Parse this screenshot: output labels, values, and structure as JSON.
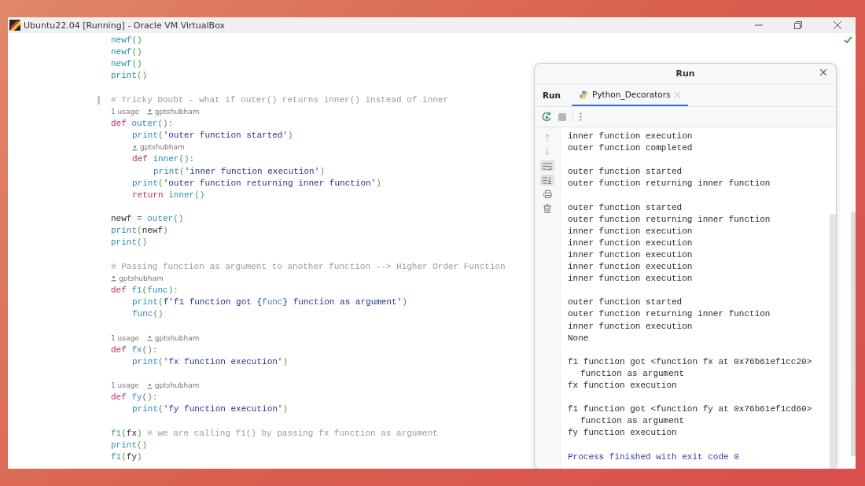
{
  "window": {
    "title": "Ubuntu22.04 [Running] - Oracle VM VirtualBox"
  },
  "editor": {
    "lines": [
      {
        "kind": "code",
        "tokens": [
          {
            "kind": "function",
            "t": "newf"
          },
          {
            "kind": "punct",
            "t": "()"
          }
        ]
      },
      {
        "kind": "code",
        "tokens": [
          {
            "kind": "function",
            "t": "newf"
          },
          {
            "kind": "punct",
            "t": "()"
          }
        ]
      },
      {
        "kind": "code",
        "tokens": [
          {
            "kind": "function",
            "t": "newf"
          },
          {
            "kind": "punct",
            "t": "()"
          }
        ]
      },
      {
        "kind": "code",
        "tokens": [
          {
            "kind": "function",
            "t": "print"
          },
          {
            "kind": "punct",
            "t": "()"
          }
        ]
      },
      {
        "kind": "blank"
      },
      {
        "kind": "code",
        "marked": true,
        "tokens": [
          {
            "kind": "comment",
            "t": "# Tricky Doubt - what if outer() returns inner() instead of inner"
          }
        ]
      },
      {
        "kind": "hint",
        "usage": "1 usage",
        "author": "gptshubham"
      },
      {
        "kind": "code",
        "tokens": [
          {
            "kind": "keyword",
            "t": "def "
          },
          {
            "kind": "function",
            "t": "outer"
          },
          {
            "kind": "punct",
            "t": "():"
          }
        ],
        "children": [
          {
            "kind": "code",
            "tokens": [
              {
                "kind": "function",
                "t": "print"
              },
              {
                "kind": "punct",
                "t": "("
              },
              {
                "kind": "string",
                "t": "'outer function started'"
              },
              {
                "kind": "punct",
                "t": ")"
              }
            ]
          },
          {
            "kind": "hint",
            "author": "gptshubham"
          },
          {
            "kind": "code",
            "tokens": [
              {
                "kind": "keyword",
                "t": "def "
              },
              {
                "kind": "function",
                "t": "inner"
              },
              {
                "kind": "punct",
                "t": "():"
              }
            ],
            "children": [
              {
                "kind": "code",
                "tokens": [
                  {
                    "kind": "function",
                    "t": "print"
                  },
                  {
                    "kind": "punct",
                    "t": "("
                  },
                  {
                    "kind": "string",
                    "t": "'inner function execution'"
                  },
                  {
                    "kind": "punct",
                    "t": ")"
                  }
                ]
              }
            ]
          },
          {
            "kind": "code",
            "tokens": [
              {
                "kind": "function",
                "t": "print"
              },
              {
                "kind": "punct",
                "t": "("
              },
              {
                "kind": "string",
                "t": "'outer function returning inner function'"
              },
              {
                "kind": "punct",
                "t": ")"
              }
            ]
          },
          {
            "kind": "code",
            "tokens": [
              {
                "kind": "keyword",
                "t": "return "
              },
              {
                "kind": "function",
                "t": "inner"
              },
              {
                "kind": "punct",
                "t": "()"
              }
            ]
          }
        ]
      },
      {
        "kind": "blank"
      },
      {
        "kind": "code",
        "tokens": [
          {
            "kind": "name",
            "t": "newf "
          },
          {
            "kind": "keyword",
            "t": "= "
          },
          {
            "kind": "function",
            "t": "outer"
          },
          {
            "kind": "punct",
            "t": "()"
          }
        ]
      },
      {
        "kind": "code",
        "tokens": [
          {
            "kind": "function",
            "t": "print"
          },
          {
            "kind": "punct",
            "t": "("
          },
          {
            "kind": "name",
            "t": "newf"
          },
          {
            "kind": "punct",
            "t": ")"
          }
        ]
      },
      {
        "kind": "code",
        "tokens": [
          {
            "kind": "function",
            "t": "print"
          },
          {
            "kind": "punct",
            "t": "()"
          }
        ]
      },
      {
        "kind": "blank"
      },
      {
        "kind": "code",
        "tokens": [
          {
            "kind": "comment",
            "t": "# Passing function as argument to another function --> Higher Order Function"
          }
        ]
      },
      {
        "kind": "hint",
        "author": "gptshubham"
      },
      {
        "kind": "code",
        "tokens": [
          {
            "kind": "keyword",
            "t": "def "
          },
          {
            "kind": "function",
            "t": "f1"
          },
          {
            "kind": "punct",
            "t": "("
          },
          {
            "kind": "function",
            "t": "func"
          },
          {
            "kind": "punct",
            "t": "):"
          }
        ],
        "children": [
          {
            "kind": "code",
            "tokens": [
              {
                "kind": "function",
                "t": "print"
              },
              {
                "kind": "punct",
                "t": "("
              },
              {
                "kind": "string",
                "t": "f'f1 function got {"
              },
              {
                "kind": "function",
                "t": "func"
              },
              {
                "kind": "string",
                "t": "} function as argument'"
              },
              {
                "kind": "punct",
                "t": ")"
              }
            ]
          },
          {
            "kind": "code",
            "tokens": [
              {
                "kind": "function",
                "t": "func"
              },
              {
                "kind": "punct",
                "t": "()"
              }
            ]
          }
        ]
      },
      {
        "kind": "blank"
      },
      {
        "kind": "hint",
        "usage": "1 usage",
        "author": "gptshubham"
      },
      {
        "kind": "code",
        "tokens": [
          {
            "kind": "keyword",
            "t": "def "
          },
          {
            "kind": "function",
            "t": "fx"
          },
          {
            "kind": "punct",
            "t": "():"
          }
        ],
        "children": [
          {
            "kind": "code",
            "tokens": [
              {
                "kind": "function",
                "t": "print"
              },
              {
                "kind": "punct",
                "t": "("
              },
              {
                "kind": "string",
                "t": "'fx function execution'"
              },
              {
                "kind": "punct",
                "t": ")"
              }
            ]
          }
        ]
      },
      {
        "kind": "blank"
      },
      {
        "kind": "hint",
        "usage": "1 usage",
        "author": "gptshubham"
      },
      {
        "kind": "code",
        "tokens": [
          {
            "kind": "keyword",
            "t": "def "
          },
          {
            "kind": "function",
            "t": "fy"
          },
          {
            "kind": "punct",
            "t": "():"
          }
        ],
        "children": [
          {
            "kind": "code",
            "tokens": [
              {
                "kind": "function",
                "t": "print"
              },
              {
                "kind": "punct",
                "t": "("
              },
              {
                "kind": "string",
                "t": "'fy function execution'"
              },
              {
                "kind": "punct",
                "t": ")"
              }
            ]
          }
        ]
      },
      {
        "kind": "blank"
      },
      {
        "kind": "code",
        "tokens": [
          {
            "kind": "function",
            "t": "f1"
          },
          {
            "kind": "punct",
            "t": "("
          },
          {
            "kind": "name",
            "t": "fx"
          },
          {
            "kind": "punct",
            "t": ") "
          },
          {
            "kind": "comment",
            "t": "# we are calling f1() by passing fx function as argument"
          }
        ]
      },
      {
        "kind": "code",
        "tokens": [
          {
            "kind": "function",
            "t": "print"
          },
          {
            "kind": "punct",
            "t": "()"
          }
        ]
      },
      {
        "kind": "code",
        "tokens": [
          {
            "kind": "function",
            "t": "f1"
          },
          {
            "kind": "punct",
            "t": "("
          },
          {
            "kind": "name",
            "t": "fy"
          },
          {
            "kind": "punct",
            "t": ")"
          }
        ]
      }
    ]
  },
  "run_panel": {
    "title": "Run",
    "label": "Run",
    "tabs": [
      {
        "label": "Python_Decorators",
        "selected": true
      }
    ],
    "console": [
      {
        "kind": "out",
        "text": "inner function execution"
      },
      {
        "kind": "out",
        "text": "outer function completed"
      },
      {
        "kind": "blank"
      },
      {
        "kind": "out",
        "text": "outer function started"
      },
      {
        "kind": "out",
        "text": "outer function returning inner function"
      },
      {
        "kind": "blank"
      },
      {
        "kind": "out",
        "text": "outer function started"
      },
      {
        "kind": "out",
        "text": "outer function returning inner function"
      },
      {
        "kind": "out",
        "text": "inner function execution"
      },
      {
        "kind": "out",
        "text": "inner function execution"
      },
      {
        "kind": "out",
        "text": "inner function execution"
      },
      {
        "kind": "out",
        "text": "inner function execution"
      },
      {
        "kind": "out",
        "text": "inner function execution"
      },
      {
        "kind": "blank"
      },
      {
        "kind": "out",
        "text": "outer function started"
      },
      {
        "kind": "out",
        "text": "outer function returning inner function"
      },
      {
        "kind": "out",
        "text": "inner function execution"
      },
      {
        "kind": "out",
        "text": "None"
      },
      {
        "kind": "blank"
      },
      {
        "kind": "out",
        "text": "f1 function got <function fx at 0x76b61ef1cc20>"
      },
      {
        "kind": "cont",
        "text": "function as argument"
      },
      {
        "kind": "out",
        "text": "fx function execution"
      },
      {
        "kind": "blank"
      },
      {
        "kind": "out",
        "text": "f1 function got <function fy at 0x76b61ef1cd60>"
      },
      {
        "kind": "cont",
        "text": "function as argument"
      },
      {
        "kind": "out",
        "text": "fy function execution"
      },
      {
        "kind": "blank"
      },
      {
        "kind": "exit",
        "text": "Process finished with exit code 0"
      }
    ]
  }
}
